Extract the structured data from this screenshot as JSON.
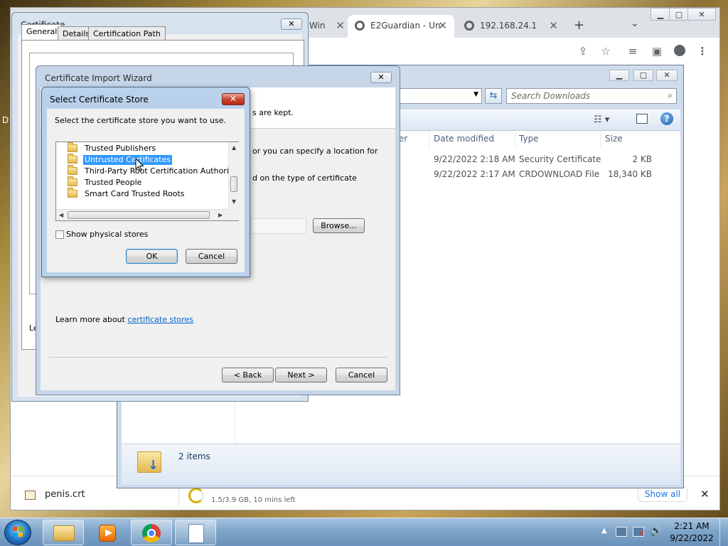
{
  "desktop": {
    "partial_icon_label": "D"
  },
  "browser": {
    "tabs": [
      {
        "label": "Win",
        "close": "✕"
      },
      {
        "label": "E2Guardian - Un",
        "close": "✕"
      },
      {
        "label": "192.168.24.1",
        "close": "✕"
      }
    ],
    "new_tab": "+",
    "tab_search": "⌄",
    "window_controls": {
      "minimize": "▁",
      "maximize": "▢",
      "close": "✕"
    },
    "toolbar_icons": [
      "share-icon",
      "star-icon",
      "tab-search-icon",
      "side-panel-icon",
      "profile-icon",
      "kebab-menu-icon"
    ],
    "download_shelf": {
      "item1_name": "penis.crt",
      "item2_status": "1.5/3.9 GB, 10 mins left",
      "show_all": "Show all",
      "close": "✕"
    }
  },
  "explorer": {
    "search_placeholder": "Search Downloads",
    "partial_header": "er",
    "columns": {
      "date": "Date modified",
      "type": "Type",
      "size": "Size"
    },
    "rows": [
      {
        "date": "9/22/2022 2:18 AM",
        "type": "Security Certificate",
        "size": "2 KB"
      },
      {
        "date": "9/22/2022 2:17 AM",
        "type": "CRDOWNLOAD File",
        "size": "18,340 KB"
      }
    ],
    "status": "2 items"
  },
  "cert_dialog": {
    "title": "Certificate",
    "tabs": [
      "General",
      "Details",
      "Certification Path"
    ],
    "partial_text": "Le"
  },
  "wizard": {
    "title": "Certificate Import Wizard",
    "line1": "s are kept.",
    "line2": "or you can specify a location for",
    "line3": "d on the type of certificate",
    "browse": "Browse...",
    "learn_more_prefix": "Learn more about ",
    "learn_more_link": "certificate stores",
    "back": "< Back",
    "next": "Next >",
    "cancel": "Cancel"
  },
  "store_dialog": {
    "title": "Select Certificate Store",
    "instruction": "Select the certificate store you want to use.",
    "items": [
      "Trusted Publishers",
      "Untrusted Certificates",
      "Third-Party Root Certification Authorities",
      "Trusted People",
      "Smart Card Trusted Roots"
    ],
    "selected_index": 1,
    "show_physical": "Show physical stores",
    "show_physical_checked": false,
    "ok": "OK",
    "cancel": "Cancel",
    "close": "✕"
  },
  "taskbar": {
    "time": "2:21 AM",
    "date": "9/22/2022",
    "pinned": [
      "explorer-icon",
      "media-player-icon",
      "chrome-icon",
      "document-icon"
    ]
  }
}
